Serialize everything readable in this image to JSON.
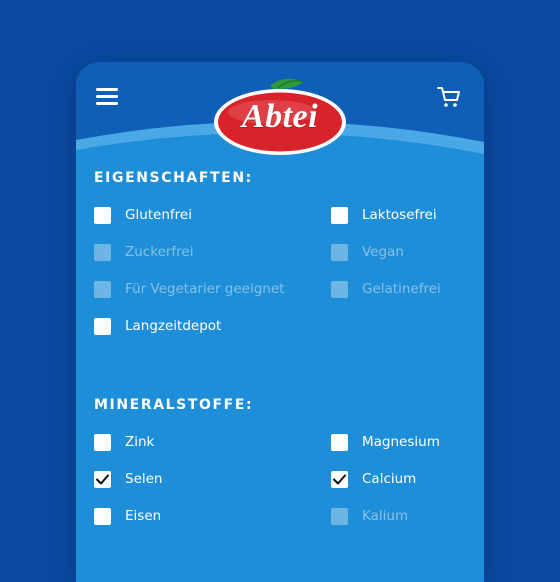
{
  "header": {
    "menu_icon": "hamburger-menu-icon",
    "cart_icon": "shopping-cart-icon",
    "logo_text": "Abtei",
    "colors": {
      "header_blue": "#0e5fb5",
      "panel_blue": "#1e8ed8",
      "logo_red": "#d8232a",
      "leaf_green": "#2f9a3a"
    }
  },
  "eigenschaften": {
    "title": "EIGENSCHAFTEN:",
    "options": [
      {
        "label": "Glutenfrei",
        "checked": false,
        "enabled": true
      },
      {
        "label": "Laktosefrei",
        "checked": false,
        "enabled": true
      },
      {
        "label": "Zuckerfrei",
        "checked": false,
        "enabled": false
      },
      {
        "label": "Vegan",
        "checked": false,
        "enabled": false
      },
      {
        "label": "Für Vegetarier geeignet",
        "checked": false,
        "enabled": false
      },
      {
        "label": "Gelatinefrei",
        "checked": false,
        "enabled": false
      },
      {
        "label": "Langzeitdepot",
        "checked": false,
        "enabled": true
      }
    ]
  },
  "mineralstoffe": {
    "title": "MINERALSTOFFE:",
    "options": [
      {
        "label": "Zink",
        "checked": false,
        "enabled": true
      },
      {
        "label": "Magnesium",
        "checked": false,
        "enabled": true
      },
      {
        "label": "Selen",
        "checked": true,
        "enabled": true
      },
      {
        "label": "Calcium",
        "checked": true,
        "enabled": true
      },
      {
        "label": "Eisen",
        "checked": false,
        "enabled": true
      },
      {
        "label": "Kalium",
        "checked": false,
        "enabled": false
      }
    ]
  }
}
